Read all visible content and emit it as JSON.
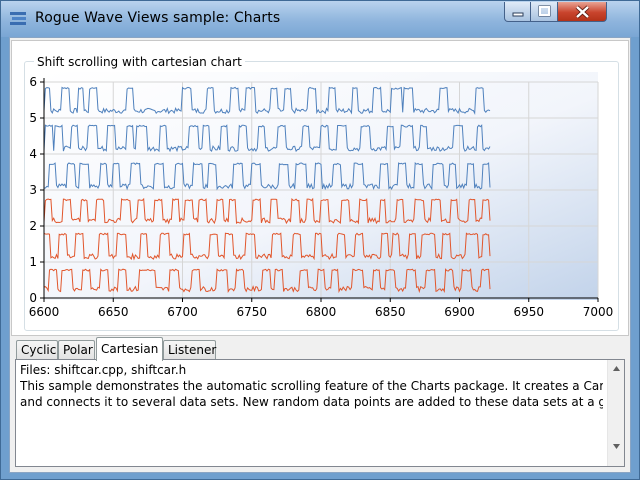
{
  "window": {
    "title": "Rogue Wave Views sample: Charts",
    "icon": "charts-app-icon",
    "controls": [
      "minimize-icon",
      "maximize-icon",
      "close-icon"
    ]
  },
  "chart_panel": {
    "group_title": "Shift scrolling with cartesian chart"
  },
  "chart_data": {
    "type": "line",
    "title": "",
    "xlabel": "",
    "ylabel": "",
    "xlim": [
      6600,
      7000
    ],
    "ylim": [
      0,
      6
    ],
    "x_ticks": [
      "6600",
      "6650",
      "6700",
      "6750",
      "6800",
      "6850",
      "6900",
      "6950",
      "7000"
    ],
    "y_ticks": [
      "0",
      "1",
      "2",
      "3",
      "4",
      "5",
      "6"
    ],
    "grid": true,
    "x_range_shown": [
      6600,
      6922
    ],
    "series": [
      {
        "color": "#4f81bd",
        "baseline": 5.2,
        "high": 5.85,
        "pulses": [
          [
            6601,
            6604
          ],
          [
            6613,
            6618
          ],
          [
            6625,
            6628
          ],
          [
            6633,
            6638
          ],
          [
            6660,
            6664
          ],
          [
            6700,
            6706
          ],
          [
            6718,
            6722
          ],
          [
            6735,
            6740
          ],
          [
            6746,
            6752
          ],
          [
            6764,
            6768
          ],
          [
            6774,
            6778
          ],
          [
            6791,
            6796
          ],
          [
            6806,
            6810
          ],
          [
            6823,
            6826
          ],
          [
            6838,
            6843
          ],
          [
            6851,
            6858
          ],
          [
            6860,
            6866
          ],
          [
            6886,
            6891
          ],
          [
            6912,
            6917
          ]
        ]
      },
      {
        "color": "#4f81bd",
        "baseline": 4.15,
        "high": 4.8,
        "pulses": [
          [
            6601,
            6606
          ],
          [
            6608,
            6613
          ],
          [
            6620,
            6624
          ],
          [
            6632,
            6638
          ],
          [
            6646,
            6651
          ],
          [
            6660,
            6664
          ],
          [
            6667,
            6674
          ],
          [
            6684,
            6688
          ],
          [
            6705,
            6711
          ],
          [
            6715,
            6719
          ],
          [
            6728,
            6732
          ],
          [
            6741,
            6746
          ],
          [
            6755,
            6759
          ],
          [
            6769,
            6774
          ],
          [
            6787,
            6791
          ],
          [
            6800,
            6805
          ],
          [
            6812,
            6818
          ],
          [
            6829,
            6835
          ],
          [
            6848,
            6852
          ],
          [
            6858,
            6866
          ],
          [
            6872,
            6876
          ],
          [
            6896,
            6902
          ],
          [
            6913,
            6916
          ]
        ]
      },
      {
        "color": "#4f81bd",
        "baseline": 3.1,
        "high": 3.75,
        "pulses": [
          [
            6604,
            6608
          ],
          [
            6617,
            6622
          ],
          [
            6626,
            6632
          ],
          [
            6641,
            6645
          ],
          [
            6650,
            6654
          ],
          [
            6663,
            6669
          ],
          [
            6680,
            6686
          ],
          [
            6695,
            6700
          ],
          [
            6708,
            6714
          ],
          [
            6719,
            6724
          ],
          [
            6737,
            6743
          ],
          [
            6750,
            6756
          ],
          [
            6770,
            6776
          ],
          [
            6782,
            6789
          ],
          [
            6796,
            6800
          ],
          [
            6809,
            6814
          ],
          [
            6824,
            6830
          ],
          [
            6843,
            6848
          ],
          [
            6856,
            6861
          ],
          [
            6868,
            6873
          ],
          [
            6881,
            6888
          ],
          [
            6893,
            6897
          ],
          [
            6906,
            6910
          ],
          [
            6917,
            6921
          ]
        ]
      },
      {
        "color": "#e1562c",
        "baseline": 2.15,
        "high": 2.75,
        "pulses": [
          [
            6601,
            6605
          ],
          [
            6614,
            6619
          ],
          [
            6627,
            6631
          ],
          [
            6638,
            6643
          ],
          [
            6656,
            6662
          ],
          [
            6668,
            6672
          ],
          [
            6680,
            6685
          ],
          [
            6693,
            6697
          ],
          [
            6702,
            6707
          ],
          [
            6712,
            6717
          ],
          [
            6725,
            6729
          ],
          [
            6734,
            6738
          ],
          [
            6751,
            6756
          ],
          [
            6764,
            6768
          ],
          [
            6779,
            6784
          ],
          [
            6790,
            6794
          ],
          [
            6800,
            6805
          ],
          [
            6815,
            6820
          ],
          [
            6828,
            6833
          ],
          [
            6843,
            6846
          ],
          [
            6855,
            6859
          ],
          [
            6868,
            6874
          ],
          [
            6880,
            6886
          ],
          [
            6894,
            6898
          ],
          [
            6907,
            6911
          ],
          [
            6917,
            6921
          ]
        ]
      },
      {
        "color": "#e1562c",
        "baseline": 1.15,
        "high": 1.8,
        "pulses": [
          [
            6600,
            6604
          ],
          [
            6611,
            6616
          ],
          [
            6623,
            6628
          ],
          [
            6640,
            6646
          ],
          [
            6653,
            6659
          ],
          [
            6670,
            6674
          ],
          [
            6684,
            6690
          ],
          [
            6701,
            6705
          ],
          [
            6720,
            6725
          ],
          [
            6731,
            6736
          ],
          [
            6746,
            6752
          ],
          [
            6765,
            6771
          ],
          [
            6780,
            6785
          ],
          [
            6796,
            6800
          ],
          [
            6812,
            6817
          ],
          [
            6825,
            6830
          ],
          [
            6844,
            6848
          ],
          [
            6852,
            6856
          ],
          [
            6864,
            6868
          ],
          [
            6873,
            6882
          ],
          [
            6888,
            6893
          ],
          [
            6905,
            6913
          ],
          [
            6917,
            6921
          ]
        ]
      },
      {
        "color": "#e1562c",
        "baseline": 0.25,
        "high": 0.8,
        "pulses": [
          [
            6604,
            6609
          ],
          [
            6613,
            6620
          ],
          [
            6628,
            6633
          ],
          [
            6641,
            6646
          ],
          [
            6654,
            6659
          ],
          [
            6669,
            6680
          ],
          [
            6691,
            6697
          ],
          [
            6707,
            6712
          ],
          [
            6725,
            6732
          ],
          [
            6739,
            6744
          ],
          [
            6758,
            6763
          ],
          [
            6767,
            6772
          ],
          [
            6785,
            6790
          ],
          [
            6798,
            6802
          ],
          [
            6808,
            6812
          ],
          [
            6823,
            6830
          ],
          [
            6838,
            6842
          ],
          [
            6847,
            6853
          ],
          [
            6862,
            6868
          ],
          [
            6876,
            6882
          ],
          [
            6890,
            6895
          ],
          [
            6902,
            6908
          ],
          [
            6916,
            6921
          ]
        ]
      }
    ]
  },
  "tabs": [
    {
      "label": "Cyclic",
      "active": false
    },
    {
      "label": "Polar",
      "active": false
    },
    {
      "label": "Cartesian",
      "active": true
    },
    {
      "label": "Listener",
      "active": false
    }
  ],
  "description": {
    "lines": [
      "Files: shiftcar.cpp, shiftcar.h",
      "This sample demonstrates the automatic scrolling feature of the Charts package. It creates a Cartesian",
      "and connects it to several data sets. New random data points are added to these data sets at a given t"
    ]
  },
  "colors": {
    "title_bar": "#8fb5dd",
    "plot_background_gradient": [
      "#ffffff",
      "#c2d3ea"
    ],
    "series_blue": "#4f81bd",
    "series_orange": "#e1562c",
    "grid": "#d6d6d6"
  }
}
